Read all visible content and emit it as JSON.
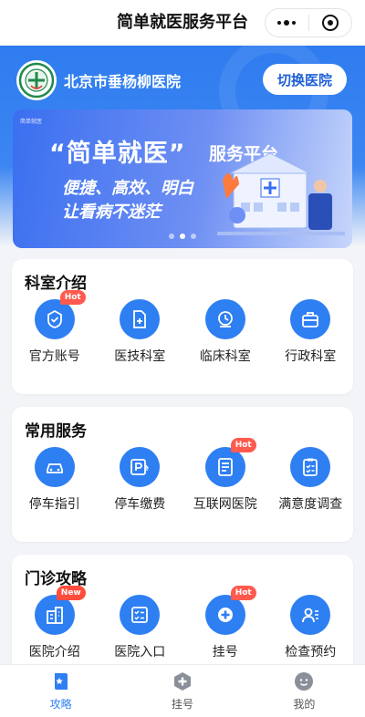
{
  "navbar": {
    "title": "简单就医服务平台"
  },
  "header": {
    "hospital_name": "北京市垂杨柳医院",
    "switch_label": "切换医院"
  },
  "banner": {
    "mini_logo": "简单就医",
    "headline": "“简单就医”",
    "headline_suffix": "服务平台",
    "line1": "便捷、高效、明白",
    "line2": "让看病不迷茫",
    "active_index": 1,
    "slide_count": 3
  },
  "sections": [
    {
      "title": "科室介绍",
      "items": [
        {
          "label": "官方账号",
          "icon": "verified-shield-icon",
          "badge": "Hot"
        },
        {
          "label": "医技科室",
          "icon": "document-plus-icon",
          "badge": ""
        },
        {
          "label": "临床科室",
          "icon": "clock-icon",
          "badge": ""
        },
        {
          "label": "行政科室",
          "icon": "briefcase-icon",
          "badge": ""
        }
      ]
    },
    {
      "title": "常用服务",
      "items": [
        {
          "label": "停车指引",
          "icon": "car-icon",
          "badge": ""
        },
        {
          "label": "停车缴费",
          "icon": "parking-payment-icon",
          "badge": ""
        },
        {
          "label": "互联网医院",
          "icon": "document-list-icon",
          "badge": "Hot"
        },
        {
          "label": "满意度调查",
          "icon": "clipboard-checklist-icon",
          "badge": ""
        }
      ]
    },
    {
      "title": "门诊攻略",
      "items": [
        {
          "label": "医院介绍",
          "icon": "building-icon",
          "badge": "New"
        },
        {
          "label": "医院入口",
          "icon": "checklist-icon",
          "badge": ""
        },
        {
          "label": "挂号",
          "icon": "medical-cross-icon",
          "badge": "Hot"
        },
        {
          "label": "检查预约",
          "icon": "person-card-icon",
          "badge": ""
        }
      ]
    }
  ],
  "tabbar": [
    {
      "label": "攻略",
      "icon": "book-icon",
      "active": true
    },
    {
      "label": "挂号",
      "icon": "plus-shield-icon",
      "active": false
    },
    {
      "label": "我的",
      "icon": "user-face-icon",
      "active": false
    }
  ],
  "colors": {
    "primary": "#2e7ff2",
    "hot_badge": "#ff5a4e",
    "header_blue": "#2f7cf0"
  }
}
